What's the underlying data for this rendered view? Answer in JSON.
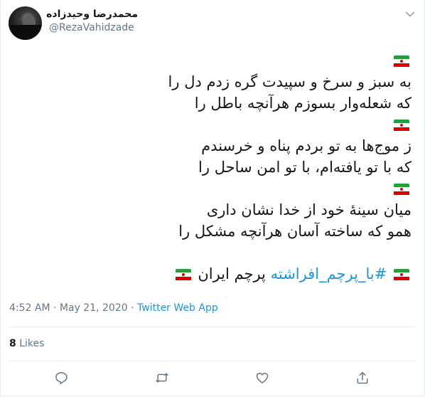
{
  "author": {
    "name": "محمدرضا وحیدزاده",
    "handle": "@RezaVahidzade"
  },
  "icons": {
    "avatar": "profile-photo",
    "menu": "chevron-down-icon",
    "flag": "iran-flag-emoji",
    "reply": "reply-icon",
    "retweet": "retweet-icon",
    "like": "heart-icon",
    "share": "share-icon"
  },
  "tweet": {
    "line1": "به سبز و سرخ و سپیدت گره زدم دل را",
    "line2": "که شعله‌وار بسوزم هرآنچه باطل را",
    "line3": "ز موج‌ها به تو بردم پناه و خرسندم",
    "line4": "که با تو یافته‌ام، با تو امن ساحل را",
    "line5": "میان سینهٔ خود از خدا نشان داری",
    "line6": "همو که ساخته آسان هرآنچه مشکل را",
    "hashtag": "#با_پرچم_افراشته",
    "hashtag_tail": "پرچم ایران"
  },
  "meta": {
    "time": "4:52 AM",
    "date": "May 21, 2020",
    "dot": "·",
    "source": "Twitter Web App"
  },
  "stats": {
    "likes_count": "8",
    "likes_label": "Likes"
  },
  "colors": {
    "accent": "#1b95e0",
    "muted": "#657786",
    "text": "#14171a",
    "divider": "#e6ecf0"
  }
}
